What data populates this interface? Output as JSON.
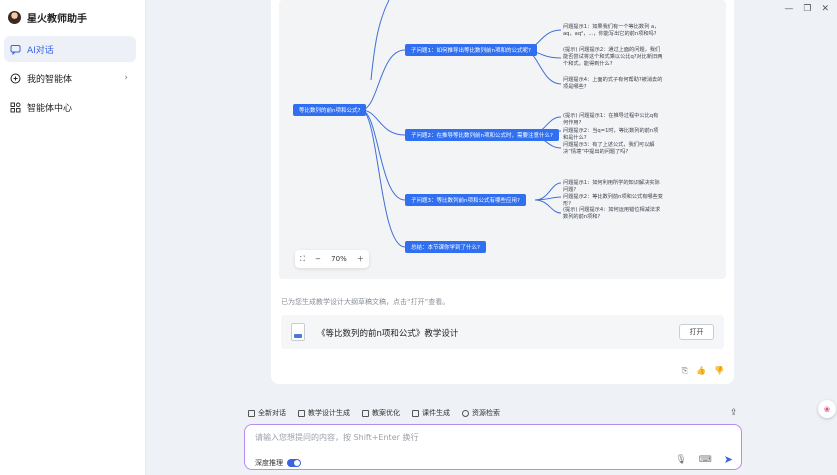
{
  "app": {
    "title": "星火教师助手"
  },
  "sidebar": {
    "items": [
      {
        "label": "AI对话",
        "icon": "chat-icon",
        "active": true
      },
      {
        "label": "我的智能体",
        "icon": "agent-icon",
        "has_arrow": true
      },
      {
        "label": "智能体中心",
        "icon": "grid-icon"
      }
    ]
  },
  "mindmap": {
    "root": "等比数列的前n项和公式?",
    "branches": [
      {
        "label": "子问题1：如何推导出等比数列前n项和的公式呢?",
        "leaves": [
          "问题提示1：如果我们有一个等比数列 a，aq，aq²，...，你能写出它的前n项和吗?",
          "(提示) 问题提示2：通过上面的问题，我们能否尝试将这个和式乘以公比q?对比新旧两个和式，能得到什么?",
          "问题提示4：上面的式子有何帮助?被消去的项是哪些?"
        ]
      },
      {
        "label": "子问题2：在推导等比数列前n项和公式时，需要注意什么?",
        "leaves": [
          "(提示) 问题提示1：在推导过程中公比q有何作用?",
          "问题提示2：当q=1时，等比数列的前n项和是什么?",
          "问题提示3：有了上述公式，我们可以解决“情境”中提出的问题了吗?"
        ]
      },
      {
        "label": "子问题3：等比数列前n项和公式有哪些应用?",
        "leaves": [
          "问题提示1：如何利用所学的知识解决实际问题?",
          "问题提示2：等比数列前n项和公式有哪些变形?",
          "(提示) 问题提示4：如何运用错位相减法求数列的前n项和?"
        ]
      },
      {
        "label": "总结：本节课你学到了什么?",
        "leaves": []
      }
    ],
    "zoom": "70%"
  },
  "chat": {
    "notice": "已为您生成教学设计大纲草稿文稿，点击“打开”查看。",
    "file_title": "《等比数列的前n项和公式》教学设计",
    "open_label": "打开"
  },
  "tools": [
    {
      "label": "全新对话",
      "icon": "new-chat-icon"
    },
    {
      "label": "教学设计生成",
      "icon": "pen-icon"
    },
    {
      "label": "教案优化",
      "icon": "doc-icon"
    },
    {
      "label": "课件生成",
      "icon": "slides-icon"
    },
    {
      "label": "资源检索",
      "icon": "search-icon"
    }
  ],
  "input": {
    "placeholder": "请输入您想提问的内容，按 Shift+Enter 换行",
    "deep_label": "深度推理",
    "deep_on": true
  },
  "colors": {
    "accent": "#3a63e0",
    "node": "#2f6ff0",
    "input_border": "#b58cf0"
  }
}
